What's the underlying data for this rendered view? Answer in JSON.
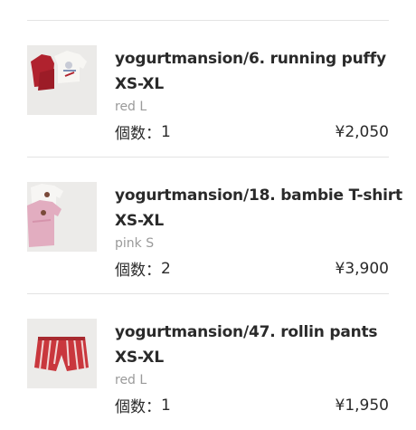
{
  "cart": {
    "items": [
      {
        "name_line1": "yogurtmansion/6. running puffy",
        "name_line2": "XS-XL",
        "variant": "red L",
        "qty_label": "個数：",
        "qty": "1",
        "price": "¥2,050"
      },
      {
        "name_line1": "yogurtmansion/18. bambie T-shirt",
        "name_line2": "XS-XL",
        "variant": "pink S",
        "qty_label": "個数：",
        "qty": "2",
        "price": "¥3,900"
      },
      {
        "name_line1": "yogurtmansion/47. rollin pants",
        "name_line2": "XS-XL",
        "variant": "red L",
        "qty_label": "個数：",
        "qty": "1",
        "price": "¥1,950"
      }
    ]
  }
}
